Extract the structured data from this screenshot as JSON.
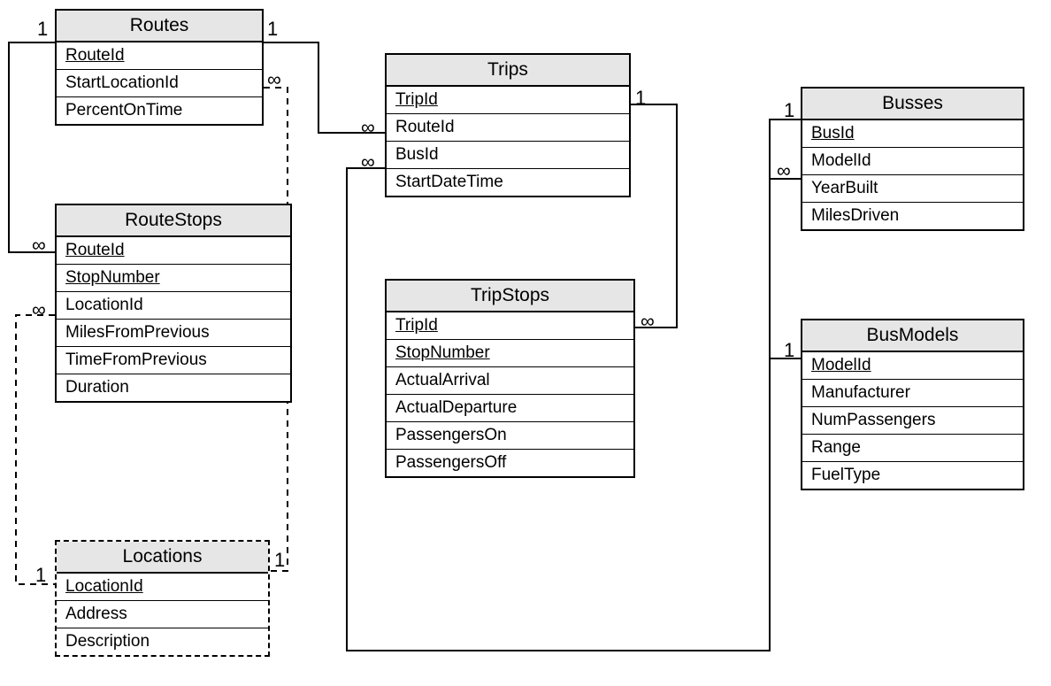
{
  "entities": {
    "routes": {
      "title": "Routes",
      "fields": [
        "RouteId",
        "StartLocationId",
        "PercentOnTime"
      ],
      "pk": [
        "RouteId"
      ]
    },
    "routeStops": {
      "title": "RouteStops",
      "fields": [
        "RouteId",
        "StopNumber",
        "LocationId",
        "MilesFromPrevious",
        "TimeFromPrevious",
        "Duration"
      ],
      "pk": [
        "RouteId",
        "StopNumber"
      ]
    },
    "locations": {
      "title": "Locations",
      "fields": [
        "LocationId",
        "Address",
        "Description"
      ],
      "pk": [
        "LocationId"
      ]
    },
    "trips": {
      "title": "Trips",
      "fields": [
        "TripId",
        "RouteId",
        "BusId",
        "StartDateTime"
      ],
      "pk": [
        "TripId"
      ]
    },
    "tripStops": {
      "title": "TripStops",
      "fields": [
        "TripId",
        "StopNumber",
        "ActualArrival",
        "ActualDeparture",
        "PassengersOn",
        "PassengersOff"
      ],
      "pk": [
        "TripId",
        "StopNumber"
      ]
    },
    "busses": {
      "title": "Busses",
      "fields": [
        "BusId",
        "ModelId",
        "YearBuilt",
        "MilesDriven"
      ],
      "pk": [
        "BusId"
      ]
    },
    "busModels": {
      "title": "BusModels",
      "fields": [
        "ModelId",
        "Manufacturer",
        "NumPassengers",
        "Range",
        "FuelType"
      ],
      "pk": [
        "ModelId"
      ]
    }
  },
  "cardinalities": {
    "routes_left_1": "1",
    "routes_right_1": "1",
    "routes_right_inf": "∞",
    "routeStops_leftTop_inf": "∞",
    "routeStops_leftMid_inf": "∞",
    "locations_left_1": "1",
    "locations_right_1": "1",
    "trips_left_inf": "∞",
    "trips_leftLower_inf": "∞",
    "trips_right_1": "1",
    "tripStops_right_inf": "∞",
    "busses_left_1": "1",
    "busses_leftLower_inf": "∞",
    "busModels_left_1": "1"
  }
}
